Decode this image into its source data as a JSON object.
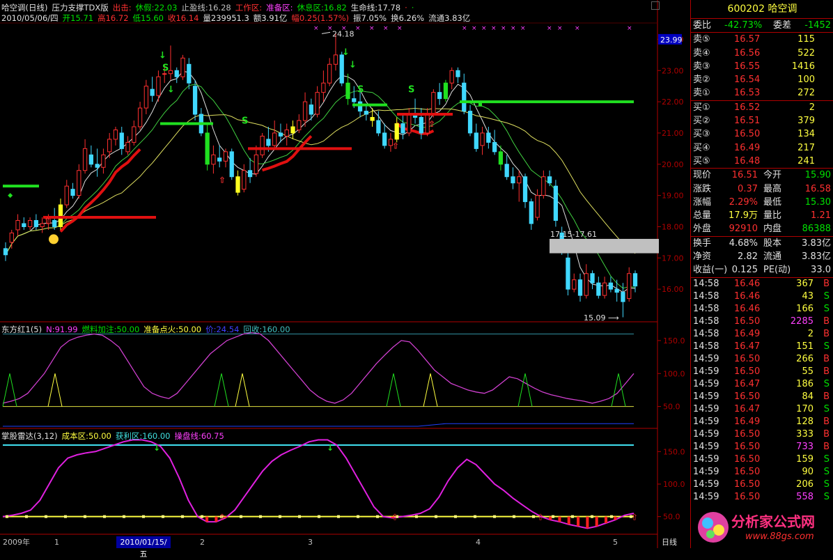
{
  "header": {
    "title": "哈空调(日线)",
    "indicator_name": "压力支撑TDX版",
    "items": [
      {
        "label": "出击:",
        "color": "#ff3030"
      },
      {
        "label": "休假:22.03",
        "color": "#00e000"
      },
      {
        "label": "止盈线:16.28",
        "color": "#c0c0c0"
      },
      {
        "label": "工作区:",
        "color": "#ff3030"
      },
      {
        "label": "准备区:",
        "color": "#ff40ff"
      },
      {
        "label": "休息区:16.82",
        "color": "#00e000"
      },
      {
        "label": "生命线:17.78",
        "color": "#e0e0e0"
      },
      {
        "label": "·",
        "color": "#ff3030"
      },
      {
        "label": "·",
        "color": "#00e000"
      }
    ],
    "line2": [
      {
        "label": "2010/05/06/四",
        "color": "#e0e0e0"
      },
      {
        "label": "开15.71",
        "color": "#00e000"
      },
      {
        "label": "高16.72",
        "color": "#ff3030"
      },
      {
        "label": "低15.60",
        "color": "#00e000"
      },
      {
        "label": "收16.14",
        "color": "#ff3030"
      },
      {
        "label": "量239951.3",
        "color": "#e0e0e0"
      },
      {
        "label": "额3.91亿",
        "color": "#e0e0e0"
      },
      {
        "label": "幅0.25(1.57%)",
        "color": "#ff3030"
      },
      {
        "label": "振7.05%",
        "color": "#e0e0e0"
      },
      {
        "label": "换6.26%",
        "color": "#e0e0e0"
      },
      {
        "label": "流通3.83亿",
        "color": "#e0e0e0"
      }
    ]
  },
  "main_price_labels": [
    "24.00",
    "23.00",
    "22.00",
    "21.00",
    "20.00",
    "19.00",
    "18.00",
    "17.00",
    "16.00"
  ],
  "price_current_box": "23.99",
  "annotations": {
    "high": "24.18",
    "low": "15.09",
    "range": "17.15-17.61",
    "s": "S"
  },
  "ind1": {
    "title": "东方红1(5)",
    "items": [
      {
        "label": "N:91.99",
        "color": "#ff40ff"
      },
      {
        "label": "燃料加注:50.00",
        "color": "#00e000"
      },
      {
        "label": "准备点火:50.00",
        "color": "#ffff40"
      },
      {
        "label": "价:24.54",
        "color": "#4040ff"
      },
      {
        "label": "回收:160.00",
        "color": "#40c0c0"
      }
    ],
    "scale": [
      "150.0",
      "100.0",
      "50.0"
    ]
  },
  "ind2": {
    "title": "掌股雷达(3,12)",
    "items": [
      {
        "label": "成本区:50.00",
        "color": "#ffff40"
      },
      {
        "label": "获利区:160.00",
        "color": "#40e0e0"
      },
      {
        "label": "操盘线:60.75",
        "color": "#ff40ff"
      }
    ],
    "scale": [
      "150.0",
      "100.0",
      "50.0"
    ]
  },
  "datebar": {
    "year": "2009年",
    "ticks": [
      "1",
      "2",
      "3",
      "4",
      "5"
    ],
    "cursor_date": "2010/01/15/五",
    "period": "日线"
  },
  "quote": {
    "code": "600202",
    "name": "哈空调",
    "weibi": {
      "label": "委比",
      "value": "-42.73%",
      "label2": "委差",
      "value2": "-1452"
    },
    "sell": [
      {
        "label": "卖⑤",
        "price": "16.57",
        "vol": "115"
      },
      {
        "label": "卖④",
        "price": "16.56",
        "vol": "522"
      },
      {
        "label": "卖③",
        "price": "16.55",
        "vol": "1416"
      },
      {
        "label": "卖②",
        "price": "16.54",
        "vol": "100"
      },
      {
        "label": "卖①",
        "price": "16.53",
        "vol": "272"
      }
    ],
    "buy": [
      {
        "label": "买①",
        "price": "16.52",
        "vol": "2"
      },
      {
        "label": "买②",
        "price": "16.51",
        "vol": "379"
      },
      {
        "label": "买③",
        "price": "16.50",
        "vol": "134"
      },
      {
        "label": "买④",
        "price": "16.49",
        "vol": "217"
      },
      {
        "label": "买⑤",
        "price": "16.48",
        "vol": "241"
      }
    ],
    "stats": [
      {
        "l1": "现价",
        "v1": "16.51",
        "c1": "#ff3030",
        "l2": "今开",
        "v2": "15.90",
        "c2": "#00e000"
      },
      {
        "l1": "涨跌",
        "v1": "0.37",
        "c1": "#ff3030",
        "l2": "最高",
        "v2": "16.58",
        "c2": "#ff3030"
      },
      {
        "l1": "涨幅",
        "v1": "2.29%",
        "c1": "#ff3030",
        "l2": "最低",
        "v2": "15.30",
        "c2": "#00e000"
      },
      {
        "l1": "总量",
        "v1": "17.9万",
        "c1": "#ffff40",
        "l2": "量比",
        "v2": "1.21",
        "c2": "#ff3030"
      },
      {
        "l1": "外盘",
        "v1": "92910",
        "c1": "#ff3030",
        "l2": "内盘",
        "v2": "86388",
        "c2": "#00e000"
      }
    ],
    "stats2": [
      {
        "l1": "换手",
        "v1": "4.68%",
        "l2": "股本",
        "v2": "3.83亿"
      },
      {
        "l1": "净资",
        "v1": "2.82",
        "l2": "流通",
        "v2": "3.83亿"
      },
      {
        "l1": "收益(一)",
        "v1": "0.125",
        "l2": "PE(动)",
        "v2": "33.0"
      }
    ],
    "ticks": [
      {
        "t": "14:58",
        "p": "16.46",
        "v": "367",
        "d": "B"
      },
      {
        "t": "14:58",
        "p": "16.46",
        "v": "43",
        "d": "S"
      },
      {
        "t": "14:58",
        "p": "16.46",
        "v": "166",
        "d": "S"
      },
      {
        "t": "14:58",
        "p": "16.50",
        "v": "2285",
        "d": "B"
      },
      {
        "t": "14:58",
        "p": "16.49",
        "v": "2",
        "d": "B"
      },
      {
        "t": "14:58",
        "p": "16.47",
        "v": "151",
        "d": "S"
      },
      {
        "t": "14:59",
        "p": "16.50",
        "v": "266",
        "d": "B"
      },
      {
        "t": "14:59",
        "p": "16.50",
        "v": "55",
        "d": "B"
      },
      {
        "t": "14:59",
        "p": "16.47",
        "v": "186",
        "d": "S"
      },
      {
        "t": "14:59",
        "p": "16.50",
        "v": "84",
        "d": "B"
      },
      {
        "t": "14:59",
        "p": "16.47",
        "v": "170",
        "d": "S"
      },
      {
        "t": "14:59",
        "p": "16.49",
        "v": "128",
        "d": "B"
      },
      {
        "t": "14:59",
        "p": "16.50",
        "v": "333",
        "d": "B"
      },
      {
        "t": "14:59",
        "p": "16.50",
        "v": "733",
        "d": "B"
      },
      {
        "t": "14:59",
        "p": "16.50",
        "v": "159",
        "d": "S"
      },
      {
        "t": "14:59",
        "p": "16.50",
        "v": "90",
        "d": "S"
      },
      {
        "t": "14:59",
        "p": "16.50",
        "v": "206",
        "d": "S"
      },
      {
        "t": "14:59",
        "p": "16.50",
        "v": "558",
        "d": "S"
      }
    ],
    "logo_text": "分析家公式网",
    "logo_url": "www.88gs.com"
  },
  "chart_data": {
    "type": "candlestick",
    "ylim": [
      15.0,
      24.5
    ],
    "ohlc": [
      [
        17.3,
        17.5,
        16.9,
        17.1
      ],
      [
        17.5,
        17.9,
        17.3,
        17.8
      ],
      [
        17.9,
        18.4,
        17.7,
        18.2
      ],
      [
        18.1,
        18.3,
        17.9,
        18.0
      ],
      [
        18.0,
        18.3,
        17.9,
        18.2
      ],
      [
        18.2,
        18.4,
        17.9,
        18.0
      ],
      [
        18.0,
        18.3,
        17.8,
        18.1
      ],
      [
        18.1,
        18.4,
        17.9,
        18.3
      ],
      [
        18.2,
        18.6,
        17.9,
        18.0
      ],
      [
        18.0,
        18.9,
        17.9,
        18.7
      ],
      [
        18.7,
        19.5,
        18.6,
        19.3
      ],
      [
        19.2,
        19.4,
        18.9,
        19.0
      ],
      [
        19.0,
        20.0,
        18.9,
        19.8
      ],
      [
        19.8,
        20.8,
        19.7,
        20.5
      ],
      [
        20.3,
        20.6,
        19.9,
        20.0
      ],
      [
        20.0,
        20.5,
        19.6,
        19.9
      ],
      [
        19.9,
        20.5,
        19.7,
        20.3
      ],
      [
        20.4,
        21.0,
        20.2,
        20.8
      ],
      [
        20.8,
        21.2,
        20.6,
        21.1
      ],
      [
        21.0,
        21.2,
        20.3,
        20.5
      ],
      [
        20.4,
        20.9,
        20.3,
        20.7
      ],
      [
        20.7,
        21.4,
        20.6,
        21.2
      ],
      [
        21.2,
        22.0,
        21.1,
        21.8
      ],
      [
        21.8,
        22.7,
        21.6,
        22.5
      ],
      [
        22.4,
        22.8,
        22.0,
        22.2
      ],
      [
        22.2,
        23.0,
        22.0,
        22.8
      ],
      [
        22.9,
        23.2,
        22.6,
        22.9
      ],
      [
        22.9,
        23.8,
        22.7,
        23.0
      ],
      [
        23.0,
        23.1,
        22.6,
        22.8
      ],
      [
        22.8,
        23.5,
        22.7,
        23.4
      ],
      [
        23.2,
        23.4,
        22.4,
        22.6
      ],
      [
        22.5,
        22.7,
        21.4,
        21.6
      ],
      [
        21.6,
        21.8,
        20.9,
        21.0
      ],
      [
        21.0,
        21.3,
        19.8,
        20.0
      ],
      [
        20.0,
        20.6,
        19.7,
        20.3
      ],
      [
        20.2,
        20.6,
        19.9,
        20.1
      ],
      [
        20.1,
        20.5,
        19.9,
        20.4
      ],
      [
        20.4,
        20.5,
        19.5,
        19.6
      ],
      [
        19.6,
        19.8,
        19.0,
        19.1
      ],
      [
        19.2,
        20.0,
        19.1,
        19.8
      ],
      [
        19.8,
        20.2,
        19.4,
        19.6
      ],
      [
        19.7,
        20.6,
        19.6,
        20.3
      ],
      [
        20.3,
        21.0,
        20.2,
        20.9
      ],
      [
        20.8,
        21.2,
        20.4,
        20.6
      ],
      [
        20.6,
        21.4,
        20.5,
        21.0
      ],
      [
        21.0,
        21.3,
        20.7,
        20.9
      ],
      [
        20.9,
        21.3,
        20.6,
        21.1
      ],
      [
        21.0,
        21.4,
        20.8,
        21.2
      ],
      [
        21.1,
        21.6,
        21.0,
        21.4
      ],
      [
        21.4,
        22.3,
        21.2,
        22.0
      ],
      [
        21.9,
        22.1,
        21.4,
        21.6
      ],
      [
        21.6,
        22.5,
        21.5,
        22.3
      ],
      [
        22.3,
        23.0,
        22.0,
        22.6
      ],
      [
        22.6,
        23.4,
        22.5,
        23.2
      ],
      [
        23.2,
        24.2,
        23.0,
        23.5
      ],
      [
        23.5,
        23.6,
        22.5,
        22.6
      ],
      [
        22.6,
        22.9,
        21.9,
        22.1
      ],
      [
        22.1,
        22.5,
        21.8,
        22.0
      ],
      [
        22.0,
        22.3,
        21.5,
        21.7
      ],
      [
        21.7,
        21.9,
        21.4,
        21.6
      ],
      [
        21.5,
        21.8,
        21.2,
        21.4
      ],
      [
        21.4,
        21.7,
        20.9,
        21.0
      ],
      [
        21.0,
        21.3,
        20.5,
        20.6
      ],
      [
        20.6,
        21.0,
        20.4,
        20.8
      ],
      [
        20.8,
        21.5,
        20.7,
        21.3
      ],
      [
        21.3,
        21.6,
        20.8,
        21.0
      ],
      [
        21.0,
        21.8,
        20.9,
        21.6
      ],
      [
        21.6,
        22.1,
        21.3,
        21.5
      ],
      [
        21.5,
        21.8,
        20.8,
        21.0
      ],
      [
        21.0,
        21.8,
        20.9,
        21.6
      ],
      [
        21.6,
        22.4,
        21.5,
        22.3
      ],
      [
        22.3,
        22.6,
        21.9,
        22.1
      ],
      [
        22.1,
        22.7,
        22.0,
        22.6
      ],
      [
        22.6,
        23.1,
        22.4,
        23.0
      ],
      [
        23.0,
        23.1,
        22.6,
        22.8
      ],
      [
        22.6,
        22.9,
        21.6,
        21.7
      ],
      [
        21.7,
        21.9,
        20.9,
        21.0
      ],
      [
        21.0,
        21.3,
        20.4,
        20.5
      ],
      [
        20.6,
        21.2,
        20.3,
        21.0
      ],
      [
        21.0,
        21.2,
        20.5,
        20.7
      ],
      [
        20.7,
        21.1,
        20.3,
        20.4
      ],
      [
        20.4,
        20.6,
        19.8,
        20.0
      ],
      [
        20.0,
        20.3,
        19.5,
        19.6
      ],
      [
        19.6,
        19.9,
        19.2,
        19.4
      ],
      [
        19.4,
        19.8,
        18.8,
        19.6
      ],
      [
        19.6,
        19.7,
        18.6,
        18.8
      ],
      [
        18.8,
        18.9,
        17.9,
        18.1
      ],
      [
        18.3,
        19.2,
        18.2,
        19.0
      ],
      [
        19.0,
        19.8,
        18.9,
        19.6
      ],
      [
        19.6,
        19.8,
        19.3,
        19.4
      ],
      [
        19.3,
        19.5,
        18.0,
        18.2
      ],
      [
        17.8,
        18.0,
        17.1,
        17.2
      ],
      [
        17.0,
        17.4,
        15.8,
        16.0
      ],
      [
        16.0,
        16.5,
        15.9,
        16.3
      ],
      [
        16.3,
        16.5,
        15.6,
        15.8
      ],
      [
        15.8,
        16.8,
        15.7,
        16.5
      ],
      [
        16.5,
        16.6,
        16.0,
        16.2
      ],
      [
        16.2,
        16.4,
        15.7,
        15.8
      ],
      [
        15.8,
        16.4,
        15.7,
        16.2
      ],
      [
        16.2,
        16.4,
        15.9,
        16.0
      ],
      [
        16.0,
        16.3,
        15.6,
        15.9
      ],
      [
        15.9,
        16.2,
        15.1,
        15.6
      ],
      [
        15.7,
        16.7,
        15.6,
        16.5
      ],
      [
        16.5,
        16.6,
        15.9,
        16.1
      ]
    ]
  }
}
